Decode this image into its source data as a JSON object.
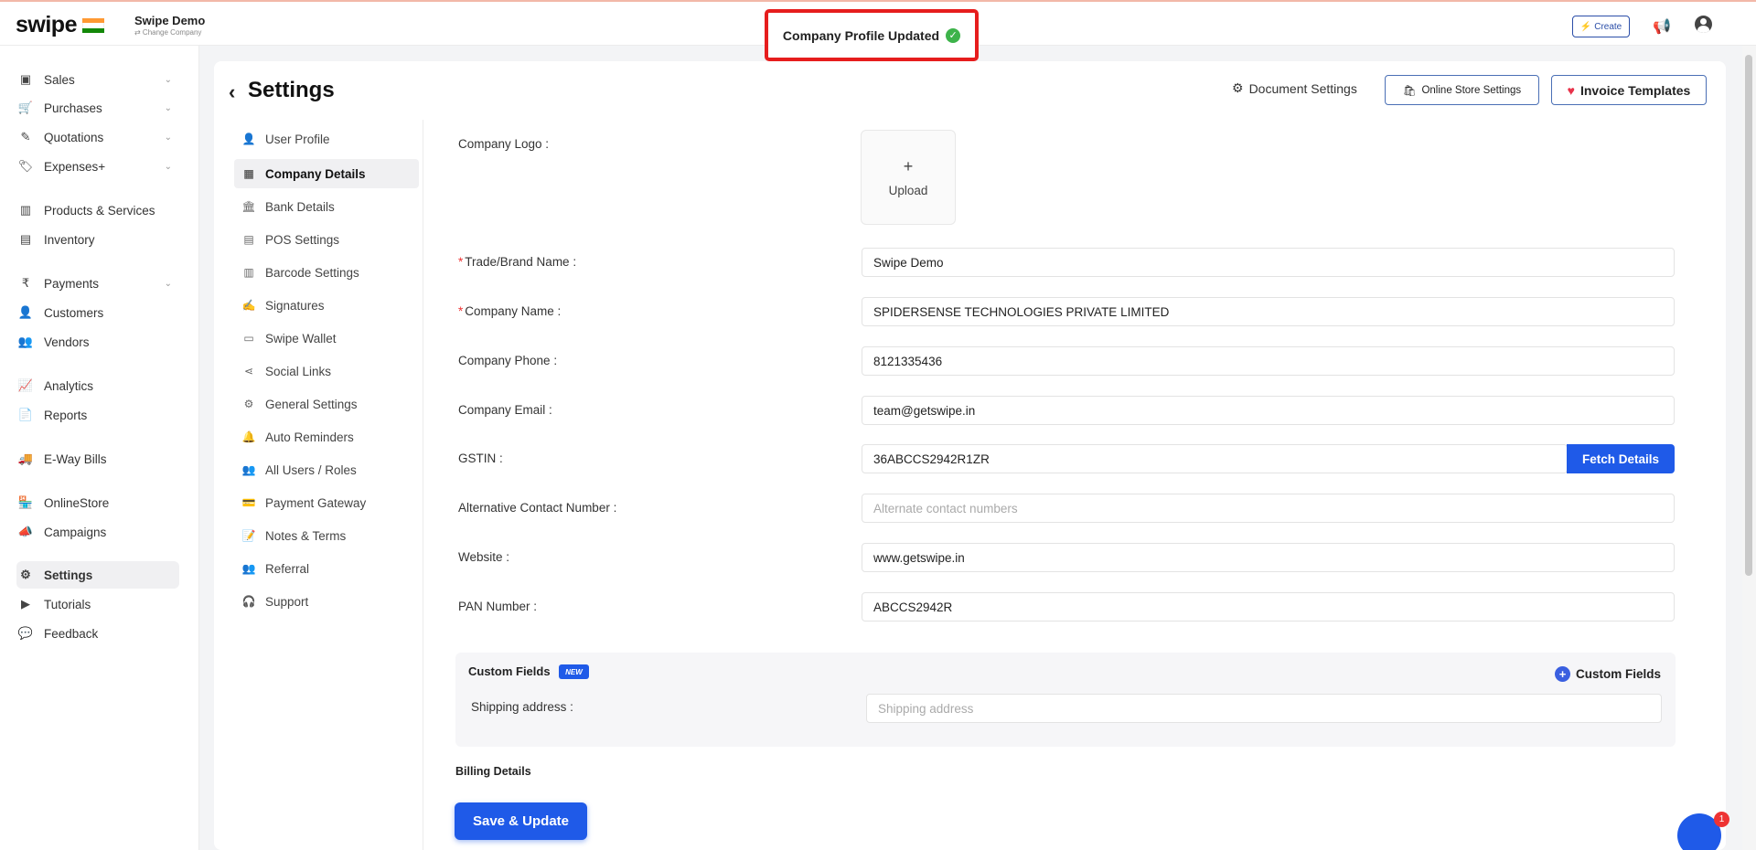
{
  "header": {
    "logo": "swipe",
    "company_name": "Swipe Demo",
    "company_sub": "⇄ Change Company",
    "toast": "Company Profile Updated",
    "create_label": "Create"
  },
  "sidebar": {
    "items": [
      {
        "label": "Sales",
        "icon": "sales-icon",
        "has_chevron": true
      },
      {
        "label": "Purchases",
        "icon": "cart-icon",
        "has_chevron": true
      },
      {
        "label": "Quotations",
        "icon": "pen-icon",
        "has_chevron": true
      },
      {
        "label": "Expenses+",
        "icon": "tag-icon",
        "has_chevron": true
      },
      {
        "label": "Products & Services",
        "icon": "barcode-icon"
      },
      {
        "label": "Inventory",
        "icon": "inventory-icon"
      },
      {
        "label": "Payments",
        "icon": "rupee-icon",
        "has_chevron": true
      },
      {
        "label": "Customers",
        "icon": "user-icon"
      },
      {
        "label": "Vendors",
        "icon": "users-icon"
      },
      {
        "label": "Analytics",
        "icon": "chart-icon"
      },
      {
        "label": "Reports",
        "icon": "report-icon"
      },
      {
        "label": "E-Way Bills",
        "icon": "truck-icon"
      },
      {
        "label": "OnlineStore",
        "icon": "store-icon"
      },
      {
        "label": "Campaigns",
        "icon": "megaphone-icon"
      },
      {
        "label": "Settings",
        "icon": "gear-icon",
        "active": true
      },
      {
        "label": "Tutorials",
        "icon": "youtube-icon"
      },
      {
        "label": "Feedback",
        "icon": "feedback-icon"
      }
    ]
  },
  "page": {
    "title": "Settings",
    "document_settings": "Document Settings",
    "online_store_settings": "Online Store Settings",
    "invoice_templates": "Invoice Templates"
  },
  "subnav": {
    "items": [
      {
        "label": "User Profile"
      },
      {
        "label": "Company Details",
        "active": true
      },
      {
        "label": "Bank Details"
      },
      {
        "label": "POS Settings"
      },
      {
        "label": "Barcode Settings"
      },
      {
        "label": "Signatures"
      },
      {
        "label": "Swipe Wallet"
      },
      {
        "label": "Social Links"
      },
      {
        "label": "General Settings"
      },
      {
        "label": "Auto Reminders"
      },
      {
        "label": "All Users / Roles"
      },
      {
        "label": "Payment Gateway"
      },
      {
        "label": "Notes & Terms"
      },
      {
        "label": "Referral"
      },
      {
        "label": "Support"
      }
    ]
  },
  "form": {
    "logo_label": "Company Logo :",
    "upload_label": "Upload",
    "trade_name_label": "Trade/Brand Name :",
    "trade_name_value": "Swipe Demo",
    "company_name_label": "Company Name :",
    "company_name_value": "SPIDERSENSE TECHNOLOGIES PRIVATE LIMITED",
    "phone_label": "Company Phone :",
    "phone_value": "8121335436",
    "email_label": "Company Email :",
    "email_value": "team@getswipe.in",
    "gstin_label": "GSTIN :",
    "gstin_value": "36ABCCS2942R1ZR",
    "fetch_details": "Fetch Details",
    "alt_contact_label": "Alternative Contact Number :",
    "alt_contact_placeholder": "Alternate contact numbers",
    "website_label": "Website :",
    "website_value": "www.getswipe.in",
    "pan_label": "PAN Number :",
    "pan_value": "ABCCS2942R"
  },
  "custom_fields": {
    "title": "Custom Fields",
    "badge": "NEW",
    "add_label": "Custom Fields",
    "shipping_label": "Shipping address :",
    "shipping_placeholder": "Shipping address"
  },
  "billing": {
    "title": "Billing Details"
  },
  "actions": {
    "save": "Save & Update"
  },
  "chat": {
    "badge": "1"
  },
  "colors": {
    "primary": "#1f5ae8",
    "toast_border": "#e61d1d",
    "success": "#3db34a"
  }
}
